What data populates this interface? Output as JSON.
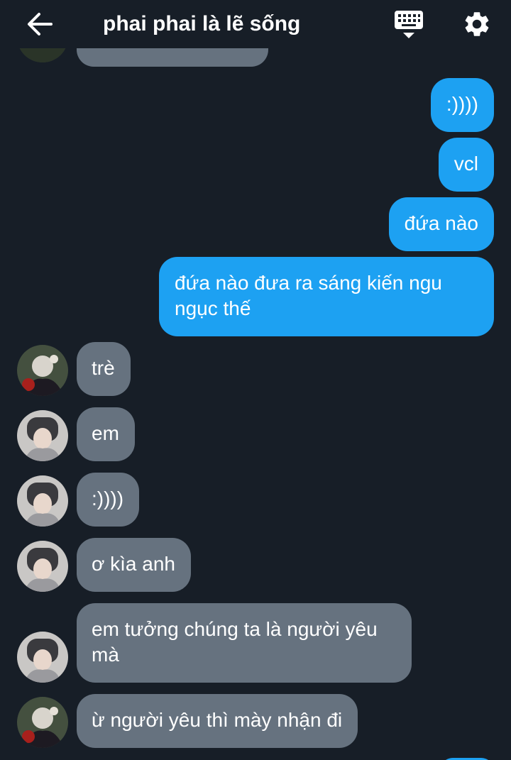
{
  "header": {
    "back_icon": "arrow-left-icon",
    "title": "phai phai là lẽ sống",
    "keyboard_icon": "keyboard-icon",
    "settings_icon": "gear-icon"
  },
  "colors": {
    "background": "#171e27",
    "outgoing_bubble": "#1da1f2",
    "incoming_bubble": "#66727f",
    "text": "#ffffff"
  },
  "messages": [
    {
      "from": "me",
      "text": ":))))"
    },
    {
      "from": "me",
      "text": "vcl"
    },
    {
      "from": "me",
      "text": "đứa nào"
    },
    {
      "from": "me",
      "text": "đứa nào đưa ra sáng kiến ngu ngục thế"
    },
    {
      "from": "other",
      "text": "trè"
    },
    {
      "from": "other",
      "text": "em"
    },
    {
      "from": "other",
      "text": ":))))"
    },
    {
      "from": "other",
      "text": "ơ kìa anh"
    },
    {
      "from": "other",
      "text": "em tưởng chúng ta là người yêu mà"
    },
    {
      "from": "other",
      "text": "ừ người yêu thì mày nhận đi"
    }
  ]
}
